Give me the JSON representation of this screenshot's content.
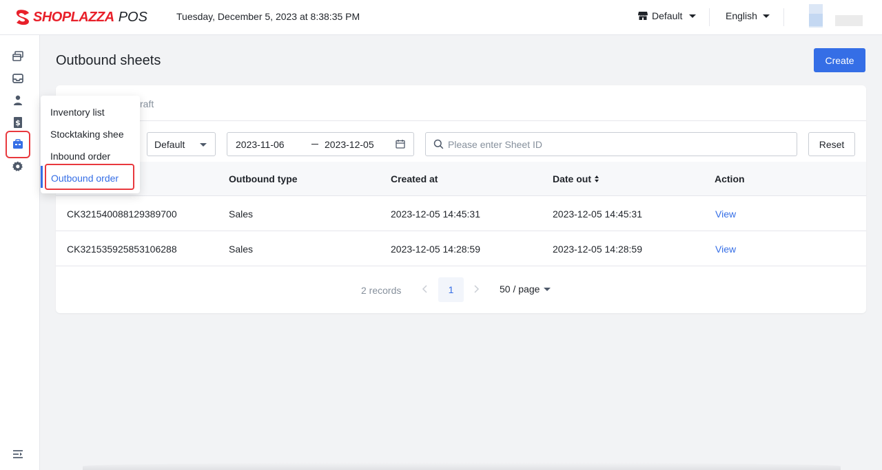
{
  "header": {
    "logo_text": "SHOPLAZZA",
    "logo_suffix": "POS",
    "datetime": "Tuesday, December 5, 2023 at 8:38:35 PM",
    "store": "Default",
    "language": "English"
  },
  "sidebar": {
    "icons": [
      "sales-icon",
      "inbox-icon",
      "customer-icon",
      "finance-icon",
      "inventory-icon",
      "settings-icon"
    ],
    "active": "inventory-icon",
    "collapse_icon": "menu-collapse-icon"
  },
  "menu": {
    "items": [
      "Inventory list",
      "Stocktaking shee",
      "Inbound order",
      "Outbound order"
    ],
    "active_index": 3
  },
  "page": {
    "title": "Outbound sheets",
    "create_label": "Create"
  },
  "tabs": {
    "draft_partial": "raft"
  },
  "filters": {
    "select_value": "Default",
    "date_start": "2023-11-06",
    "date_end": "2023-12-05",
    "search_placeholder": "Please enter Sheet ID",
    "reset_label": "Reset"
  },
  "table": {
    "columns": [
      "Outbound type",
      "Created at",
      "Date out",
      "Action"
    ],
    "rows": [
      {
        "id": "CK321540088129389700",
        "type": "Sales",
        "created": "2023-12-05 14:45:31",
        "date_out": "2023-12-05 14:45:31",
        "action": "View"
      },
      {
        "id": "CK321535925853106288",
        "type": "Sales",
        "created": "2023-12-05 14:28:59",
        "date_out": "2023-12-05 14:28:59",
        "action": "View"
      }
    ]
  },
  "pagination": {
    "records": "2 records",
    "current_page": "1",
    "page_size": "50 / page"
  },
  "colors": {
    "primary": "#356ee6",
    "brand_red": "#e8202a",
    "highlight_red": "#e8383d"
  }
}
